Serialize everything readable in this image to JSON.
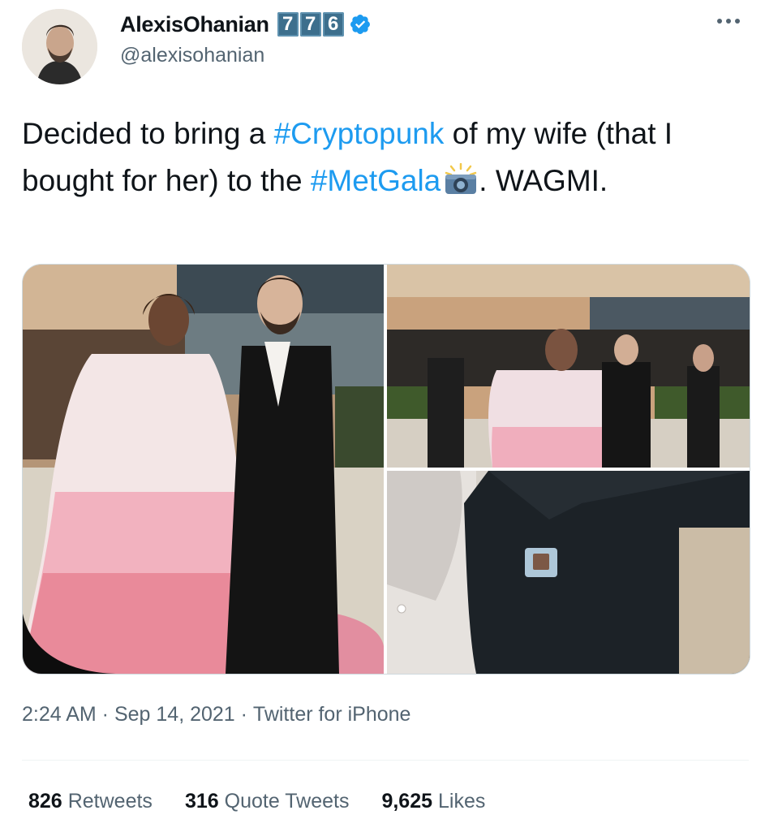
{
  "author": {
    "display_name": "AlexisOhanian",
    "name_tiles": [
      "7",
      "7",
      "6"
    ],
    "handle": "@alexisohanian",
    "verified": true,
    "avatar_icon": "avatar-photo"
  },
  "more_icon": "more-horizontal-icon",
  "tweet": {
    "text_1": "Decided to bring a ",
    "hashtag_1": "#Cryptopunk",
    "text_2": " of my wife (that I bought for her) to the ",
    "hashtag_2": "#MetGala",
    "emoji": "camera-with-flash-emoji",
    "text_3": ". WAGMI."
  },
  "photos": [
    "photo-couple-met-gala",
    "photo-red-carpet-crowd",
    "photo-lapel-pin-closeup"
  ],
  "meta": {
    "time": "2:24 AM",
    "sep1": " · ",
    "date": "Sep 14, 2021",
    "sep2": " · ",
    "source": "Twitter for iPhone"
  },
  "stats": {
    "retweets_count": "826",
    "retweets_label": "Retweets",
    "quotes_count": "316",
    "quotes_label": "Quote Tweets",
    "likes_count": "9,625",
    "likes_label": "Likes"
  },
  "colors": {
    "link": "#1d9bf0",
    "secondary_text": "#536471",
    "primary_text": "#0f1419",
    "tile_bg": "#3d6f8d",
    "verified_blue": "#1d9bf0"
  }
}
